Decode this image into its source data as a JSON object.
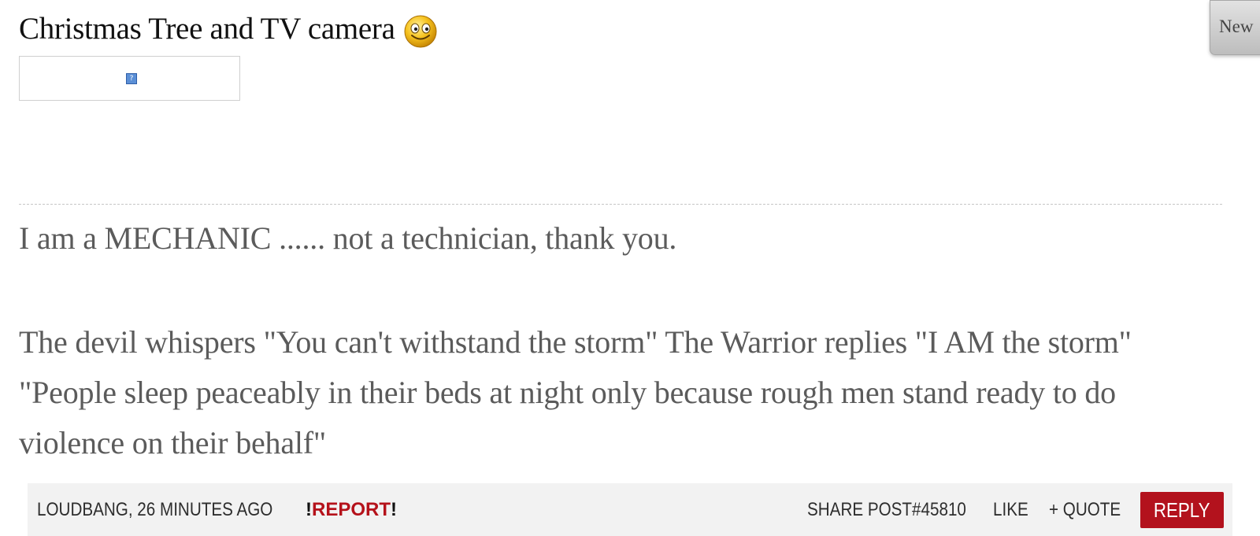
{
  "post": {
    "title": "Christmas Tree and TV camera",
    "emoji_icon": "smiley-face-icon",
    "image_placeholder_icon": "broken-image-icon",
    "image_placeholder_glyph": "?"
  },
  "top_right_tab": {
    "label": "New"
  },
  "signature": {
    "line1": "I am a MECHANIC ...... not a technician, thank you.",
    "line2": "The devil whispers \"You can't withstand the storm\" The Warrior replies \"I AM the storm\"",
    "line3": "\"People sleep peaceably in their beds at night only because rough men stand ready to do",
    "line4": "violence on their behalf\""
  },
  "footer": {
    "author_time": "LOUDBANG, 26 MINUTES AGO",
    "report_prefix": "!",
    "report_label": "REPORT",
    "report_suffix": "!",
    "share_label": "SHARE POST#45810",
    "like_label": "LIKE",
    "quote_label": "+ QUOTE",
    "reply_label": "REPLY"
  },
  "colors": {
    "accent_red": "#b3121d",
    "report_red": "#b5121b",
    "signature_text": "#5b5b5b",
    "footer_bg": "#f2f2f2"
  }
}
